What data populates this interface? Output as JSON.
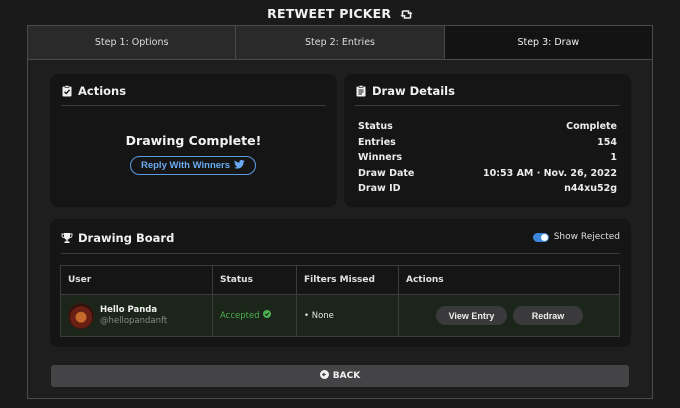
{
  "app": {
    "title": "RETWEET PICKER",
    "icon": "retweet-icon"
  },
  "tabs": [
    {
      "label": "Step 1: Options",
      "active": false
    },
    {
      "label": "Step 2: Entries",
      "active": false
    },
    {
      "label": "Step 3: Draw",
      "active": true
    }
  ],
  "actions": {
    "title": "Actions",
    "icon": "clipboard-check-icon",
    "message": "Drawing Complete!",
    "reply_button": "Reply With Winners",
    "reply_icon": "twitter-bird-icon",
    "accent": "#6aaaf0"
  },
  "draw_details": {
    "title": "Draw Details",
    "icon": "clipboard-list-icon",
    "rows": [
      {
        "label": "Status",
        "value": "Complete"
      },
      {
        "label": "Entries",
        "value": "154"
      },
      {
        "label": "Winners",
        "value": "1"
      },
      {
        "label": "Draw Date",
        "value": "10:53 AM · Nov. 26, 2022"
      },
      {
        "label": "Draw ID",
        "value": "n44xu52g"
      }
    ]
  },
  "drawing_board": {
    "title": "Drawing Board",
    "icon": "trophy-icon",
    "toggle": {
      "label": "Show Rejected",
      "on": true,
      "color": "#3b86d9"
    },
    "columns": [
      "User",
      "Status",
      "Filters Missed",
      "Actions"
    ],
    "rows": [
      {
        "name": "Hello Panda",
        "handle": "@hellopandanft",
        "status": "Accepted",
        "status_color": "#4caf50",
        "filters_missed": "• None",
        "view_button": "View Entry",
        "redraw_button": "Redraw"
      }
    ]
  },
  "back_button": {
    "label": "BACK",
    "icon": "arrow-left-circle-icon"
  }
}
